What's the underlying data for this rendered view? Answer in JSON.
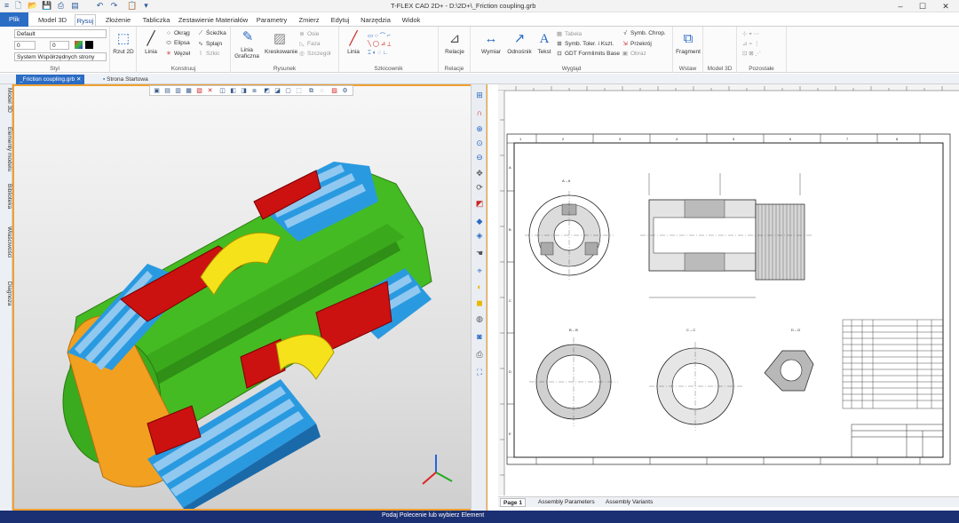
{
  "app": {
    "title": "T-FLEX CAD 2D+ - D:\\2D+\\_Friction coupling.grb"
  },
  "menu": {
    "tabs": [
      "Plik",
      "Model 3D",
      "Rysuj",
      "Złożenie",
      "Tabliczka",
      "Zestawienie Materiałów",
      "Parametry",
      "Zmierz",
      "Edytuj",
      "Narzędzia",
      "Widok"
    ]
  },
  "ribbon": {
    "styl": {
      "label": "Styl",
      "layer": "Default",
      "line_width": "0",
      "hatch_val": "0",
      "coord_system": "System Współrzędnych strony"
    },
    "rzut": {
      "btn": "Rzut 2D"
    },
    "konstruuj": {
      "label": "Konstruuj",
      "linia": "Linia",
      "okrag": "Okrąg",
      "elipsa": "Elipsa",
      "wezel": "Węzeł",
      "sciezka": "Ścieżka",
      "splajn": "Splajn",
      "szkic": "Szkic"
    },
    "rysunek": {
      "label": "Rysunek",
      "linia_graficzna": "Linia Graficzna",
      "kreskowanie": "Kreskowanie",
      "osie": "Osie",
      "faza": "Faza",
      "szczegol": "Szczegół"
    },
    "szkicownik": {
      "label": "Szkicownik",
      "linia": "Linia"
    },
    "relacje": {
      "label": "Relacje",
      "btn": "Relacje"
    },
    "wyglad": {
      "label": "Wygląd",
      "wymiar": "Wymiar",
      "odnosnik": "Odnośnik",
      "tekst": "Tekst",
      "tabela": "Tabela",
      "symb_toler": "Symb. Toler. i Kszt.",
      "gdt": "GDT Formlimits Base",
      "symb_chrop": "Symb. Chrop.",
      "przekroj": "Przekrój",
      "obraz": "Obraz"
    },
    "wstaw": {
      "label": "Wstaw",
      "fragment": "Fragment"
    },
    "model3d": {
      "label": "Model 3D"
    },
    "pozostale": {
      "label": "Pozostałe"
    }
  },
  "documents": {
    "tabs": [
      "_Friction coupling.grb",
      "Strona Startowa"
    ]
  },
  "left_panel": {
    "items": [
      "Model 3D",
      "Elementy modelu",
      "Biblioteka",
      "Właściwości",
      "Diagnoza"
    ]
  },
  "sheet": {
    "section_labels": [
      "A – A",
      "B – B",
      "C – C",
      "D – D"
    ],
    "col_numbers": [
      "1",
      "2",
      "3",
      "4",
      "5",
      "6",
      "7",
      "8"
    ],
    "row_letters": [
      "A",
      "B",
      "C",
      "D",
      "E"
    ]
  },
  "bottom_tabs": [
    "Page 1",
    "Assembly Parameters",
    "Assembly Variants"
  ],
  "status": {
    "text": "Podaj Polecenie lub wybierz Element"
  },
  "colors": {
    "accent": "#2b6cc4",
    "status": "#1b2f73",
    "selected_border": "#f0a030",
    "green": "#44bb22",
    "blue": "#2a9ae0",
    "red": "#cc1111",
    "yellow": "#f5e21a",
    "orange": "#f2a020"
  }
}
